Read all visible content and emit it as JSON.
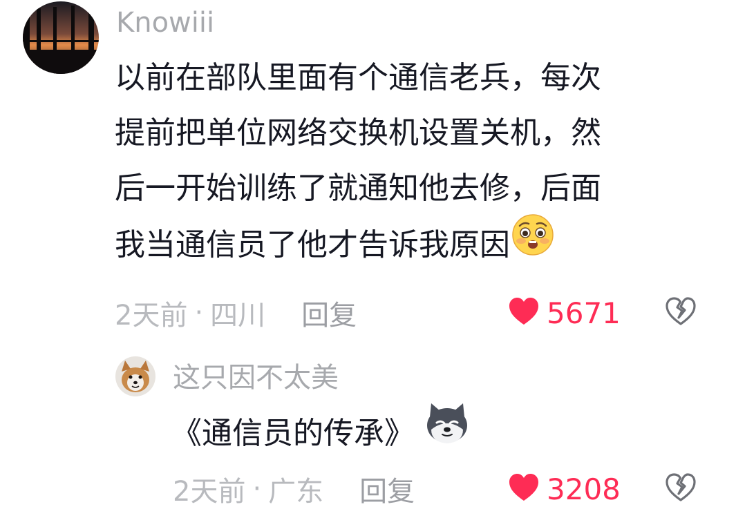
{
  "comment": {
    "username": "Knowiii",
    "lines": [
      "以前在部队里面有个通信老兵，每次",
      "提前把单位网络交换机设置关机，然",
      "后一开始训练了就通知他去修，后面",
      "我当通信员了他才告诉我原因"
    ],
    "time": "2天前",
    "separator": "·",
    "location": "四川",
    "reply_label": "回复",
    "like_count": "5671"
  },
  "reply": {
    "username": "这只因不太美",
    "text": "《通信员的传承》",
    "time": "2天前",
    "separator": "·",
    "location": "广东",
    "reply_label": "回复",
    "like_count": "3208"
  },
  "colors": {
    "like": "#fe2c55",
    "muted": "#a7a9ad",
    "text": "#161823"
  },
  "icons": {
    "like": "heart-icon",
    "dislike": "broken-heart-icon",
    "emoji_comment": "pleading-face-emoji",
    "emoji_reply": "husky-dog-emoji"
  }
}
